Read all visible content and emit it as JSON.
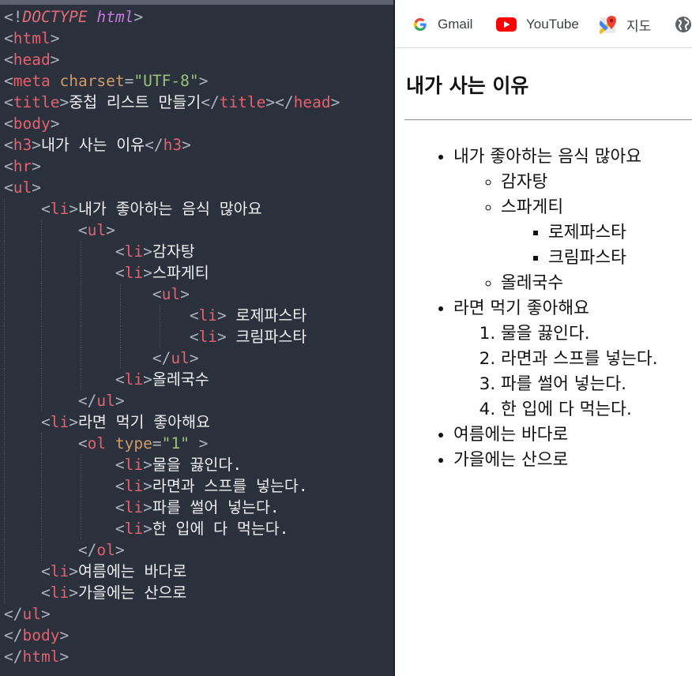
{
  "editor": {
    "lines": {
      "l01": {
        "doctype": "DOCTYPE",
        "html": "html"
      },
      "l02": {
        "tag": "html"
      },
      "l03": {
        "tag": "head"
      },
      "l04": {
        "tag": "meta",
        "attr": "charset",
        "value": "\"UTF-8\""
      },
      "l05": {
        "tag1": "title",
        "text": "중첩 리스트 만들기",
        "tag2": "title",
        "tag3": "head"
      },
      "l06": {
        "tag": "body"
      },
      "l07": {
        "tag1": "h3",
        "text": "내가 사는 이유",
        "tag2": "h3"
      },
      "l08": {
        "tag": "hr"
      },
      "l09": {
        "tag": "ul"
      },
      "l10": {
        "tag": "li",
        "text": "내가 좋아하는 음식 많아요"
      },
      "l11": {
        "tag": "ul"
      },
      "l12": {
        "tag": "li",
        "text": "감자탕"
      },
      "l13": {
        "tag": "li",
        "text": "스파게티"
      },
      "l14": {
        "tag": "ul"
      },
      "l15": {
        "tag": "li",
        "text": " 로제파스타"
      },
      "l16": {
        "tag": "li",
        "text": " 크림파스타"
      },
      "l17": {
        "tag": "ul"
      },
      "l18": {
        "tag": "li",
        "text": "올레국수"
      },
      "l19": {
        "tag": "ul"
      },
      "l20": {
        "tag": "li",
        "text": "라면 먹기 좋아해요"
      },
      "l21": {
        "tag": "ol",
        "attr": "type",
        "value": "\"1\""
      },
      "l22": {
        "tag": "li",
        "text": "물을 끓인다."
      },
      "l23": {
        "tag": "li",
        "text": "라면과 스프를 넣는다."
      },
      "l24": {
        "tag": "li",
        "text": "파를 썰어 넣는다."
      },
      "l25": {
        "tag": "li",
        "text": "한 입에 다 먹는다."
      },
      "l26": {
        "tag": "ol"
      },
      "l27": {
        "tag": "li",
        "text": "여름에는 바다로"
      },
      "l28": {
        "tag": "li",
        "text": "가을에는 산으로"
      },
      "l29": {
        "tag": "ul"
      },
      "l30": {
        "tag": "body"
      },
      "l31": {
        "tag": "html"
      }
    }
  },
  "browser": {
    "bookmarks": [
      {
        "label": "Gmail",
        "icon": "google-icon"
      },
      {
        "label": "YouTube",
        "icon": "youtube-icon"
      },
      {
        "label": "지도",
        "icon": "maps-icon"
      },
      {
        "label": "",
        "icon": "globe-icon"
      }
    ],
    "page": {
      "heading": "내가 사는 이유",
      "list": {
        "food": "내가 좋아하는 음식 많아요",
        "food_items": [
          "감자탕",
          "스파게티",
          "올레국수"
        ],
        "pasta": [
          "로제파스타",
          "크림파스타"
        ],
        "ramen": "라면 먹기 좋아해요",
        "steps": [
          "물을 끓인다.",
          "라면과 스프를 넣는다.",
          "파를 썰어 넣는다.",
          "한 입에 다 먹는다."
        ],
        "summer": "여름에는 바다로",
        "autumn": "가을에는 산으로"
      }
    }
  },
  "colors": {
    "editor_bg": "#2b313c",
    "tag": "#e5606b",
    "attribute": "#d19a66",
    "string": "#98c379",
    "punctuation": "#abb2bf",
    "keyword": "#c678dd"
  }
}
